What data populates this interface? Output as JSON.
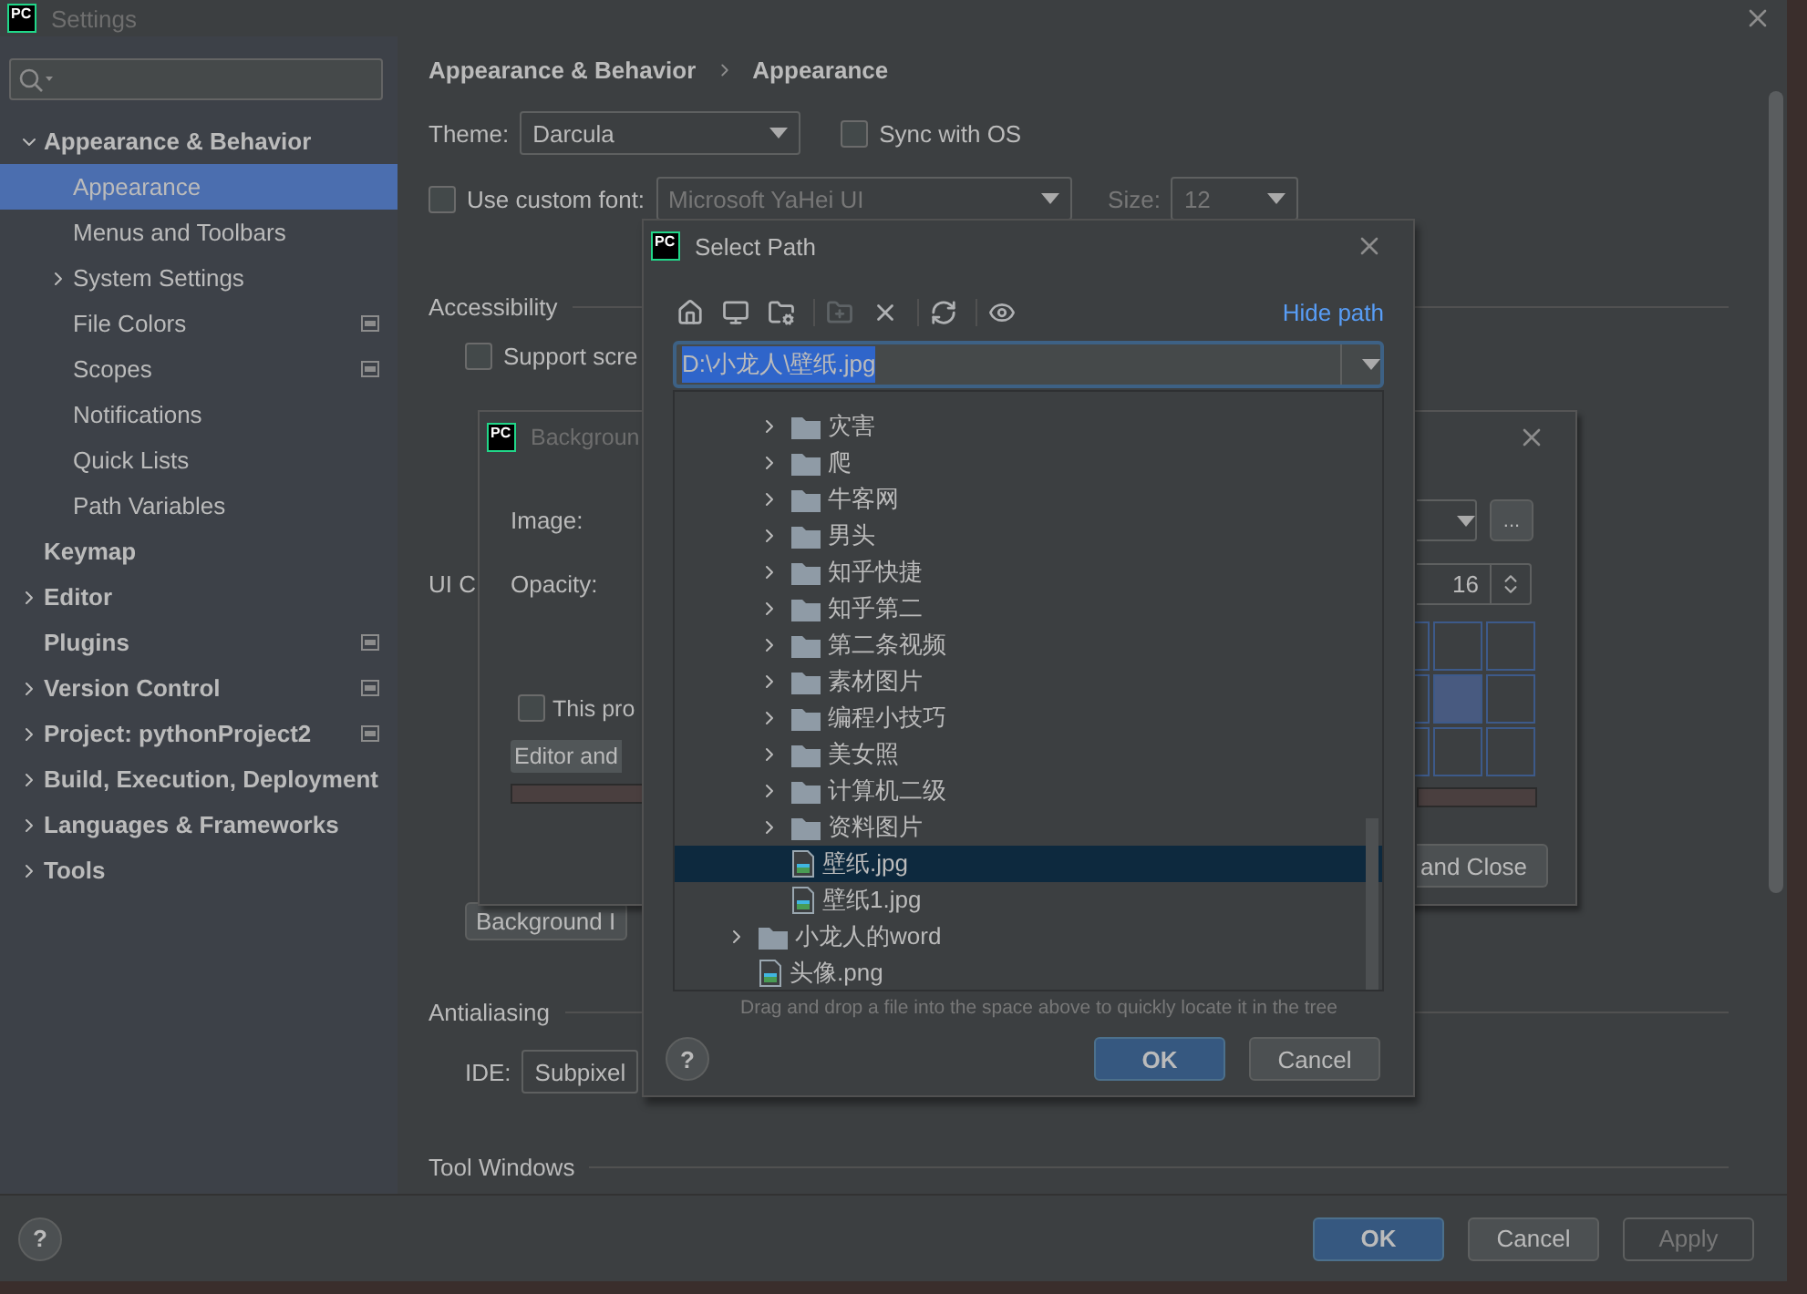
{
  "settings_window": {
    "logo": "PC",
    "title": "Settings"
  },
  "sidebar": {
    "items": [
      {
        "kind": "group",
        "label": "Appearance & Behavior",
        "expanded": true,
        "selected": false,
        "project_scope": false,
        "children": [
          {
            "kind": "leaf",
            "label": "Appearance",
            "selected": true,
            "project_scope": false
          },
          {
            "kind": "leaf",
            "label": "Menus and Toolbars",
            "selected": false,
            "project_scope": false
          },
          {
            "kind": "group",
            "label": "System Settings",
            "expanded": false,
            "selected": false,
            "project_scope": false
          },
          {
            "kind": "leaf",
            "label": "File Colors",
            "selected": false,
            "project_scope": true
          },
          {
            "kind": "leaf",
            "label": "Scopes",
            "selected": false,
            "project_scope": true
          },
          {
            "kind": "leaf",
            "label": "Notifications",
            "selected": false,
            "project_scope": false
          },
          {
            "kind": "leaf",
            "label": "Quick Lists",
            "selected": false,
            "project_scope": false
          },
          {
            "kind": "leaf",
            "label": "Path Variables",
            "selected": false,
            "project_scope": false
          }
        ]
      },
      {
        "kind": "leaf",
        "label": "Keymap",
        "selected": false,
        "project_scope": false
      },
      {
        "kind": "group",
        "label": "Editor",
        "expanded": false,
        "selected": false,
        "project_scope": false
      },
      {
        "kind": "leaf",
        "label": "Plugins",
        "selected": false,
        "project_scope": true
      },
      {
        "kind": "group",
        "label": "Version Control",
        "expanded": false,
        "selected": false,
        "project_scope": true
      },
      {
        "kind": "group",
        "label": "Project: pythonProject2",
        "expanded": false,
        "selected": false,
        "project_scope": true
      },
      {
        "kind": "group",
        "label": "Build, Execution, Deployment",
        "expanded": false,
        "selected": false,
        "project_scope": false
      },
      {
        "kind": "group",
        "label": "Languages & Frameworks",
        "expanded": false,
        "selected": false,
        "project_scope": false
      },
      {
        "kind": "group",
        "label": "Tools",
        "expanded": false,
        "selected": false,
        "project_scope": false
      }
    ]
  },
  "breadcrumb": [
    "Appearance & Behavior",
    "Appearance"
  ],
  "theme": {
    "label": "Theme:",
    "value": "Darcula"
  },
  "sync_with_os": {
    "label": "Sync with OS",
    "checked": false
  },
  "custom_font": {
    "label": "Use custom font:",
    "checked": false,
    "value": "Microsoft YaHei UI",
    "size_label": "Size:",
    "size": "12"
  },
  "accessibility": {
    "title": "Accessibility",
    "screen_readers": {
      "label": "Support scre",
      "checked": false
    }
  },
  "ui_options": {
    "title": "UI C",
    "background_button": "Background I"
  },
  "antialiasing": {
    "title": "Antialiasing",
    "ide_label": "IDE:",
    "ide_value": "Subpixel"
  },
  "tool_windows": {
    "title": "Tool Windows"
  },
  "footer": {
    "help": "?",
    "buttons": [
      {
        "label": "OK",
        "default": true,
        "disabled": false
      },
      {
        "label": "Cancel",
        "default": false,
        "disabled": false
      },
      {
        "label": "Apply",
        "default": false,
        "disabled": true
      }
    ]
  },
  "background_dialog": {
    "logo": "PC",
    "title": "Backgroun",
    "image_label": "Image:",
    "opacity_label": "Opacity:",
    "browse": "...",
    "opacity": "16",
    "this_project": {
      "label": "This pro",
      "checked": false
    },
    "tab": "Editor and",
    "anchor_cells": [
      {
        "selected": false
      },
      {
        "selected": false
      },
      {
        "selected": false
      },
      {
        "selected": false
      },
      {
        "selected": true
      },
      {
        "selected": false
      },
      {
        "selected": false
      },
      {
        "selected": false
      },
      {
        "selected": false
      }
    ],
    "close_button": "and Close"
  },
  "select_path": {
    "logo": "PC",
    "title": "Select Path",
    "toolbar": [
      [
        {
          "kind": "home",
          "disabled": false
        },
        {
          "kind": "desktop",
          "disabled": false
        },
        {
          "kind": "module",
          "disabled": false
        }
      ],
      [
        {
          "kind": "new_folder",
          "disabled": true
        },
        {
          "kind": "delete",
          "disabled": false
        }
      ],
      [
        {
          "kind": "refresh",
          "disabled": false
        }
      ],
      [
        {
          "kind": "show_hidden",
          "disabled": false
        }
      ]
    ],
    "hide_path": "Hide path",
    "path": "D:\\小龙人\\壁纸.jpg",
    "tree": [
      {
        "kind": "group",
        "children": [
          {
            "kind": "folder",
            "name": "灾害",
            "selected": false
          },
          {
            "kind": "folder",
            "name": "爬",
            "selected": false
          },
          {
            "kind": "folder",
            "name": "牛客网",
            "selected": false
          },
          {
            "kind": "folder",
            "name": "男头",
            "selected": false
          },
          {
            "kind": "folder",
            "name": "知乎快捷",
            "selected": false
          },
          {
            "kind": "folder",
            "name": "知乎第二",
            "selected": false
          },
          {
            "kind": "folder",
            "name": "第二条视频",
            "selected": false
          },
          {
            "kind": "folder",
            "name": "素材图片",
            "selected": false
          },
          {
            "kind": "folder",
            "name": "编程小技巧",
            "selected": false
          },
          {
            "kind": "folder",
            "name": "美女照",
            "selected": false
          },
          {
            "kind": "folder",
            "name": "计算机二级",
            "selected": false
          },
          {
            "kind": "folder",
            "name": "资料图片",
            "selected": false
          },
          {
            "kind": "image",
            "name": "壁纸.jpg",
            "selected": true
          },
          {
            "kind": "image",
            "name": "壁纸1.jpg",
            "selected": false
          }
        ]
      },
      {
        "kind": "folder",
        "name": "小龙人的word",
        "selected": false
      },
      {
        "kind": "image",
        "name": "头像.png",
        "selected": false
      }
    ],
    "hint": "Drag and drop a file into the space above to quickly locate it in the tree",
    "help": "?",
    "buttons": [
      {
        "label": "OK",
        "default": true,
        "disabled": false
      },
      {
        "label": "Cancel",
        "default": false,
        "disabled": false
      }
    ]
  }
}
